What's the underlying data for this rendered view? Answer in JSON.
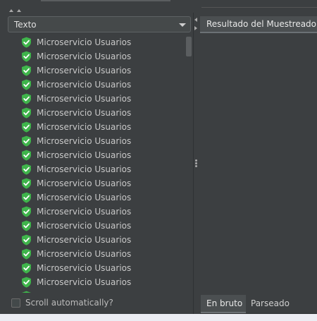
{
  "left": {
    "combo_value": "Texto",
    "items": [
      "Microservicio Usuarios",
      "Microservicio Usuarios",
      "Microservicio Usuarios",
      "Microservicio Usuarios",
      "Microservicio Usuarios",
      "Microservicio Usuarios",
      "Microservicio Usuarios",
      "Microservicio Usuarios",
      "Microservicio Usuarios",
      "Microservicio Usuarios",
      "Microservicio Usuarios",
      "Microservicio Usuarios",
      "Microservicio Usuarios",
      "Microservicio Usuarios",
      "Microservicio Usuarios",
      "Microservicio Usuarios",
      "Microservicio Usuarios",
      "Microservicio Usuarios"
    ],
    "item_icon": "shield-check-icon",
    "checkbox_label": "Scroll automatically?"
  },
  "right": {
    "panel_tab": "Resultado del Muestreador",
    "tabs": [
      "En bruto",
      "Parseado"
    ]
  },
  "colors": {
    "success_green": "#3fb44b",
    "panel_bg": "#3c3f41"
  }
}
